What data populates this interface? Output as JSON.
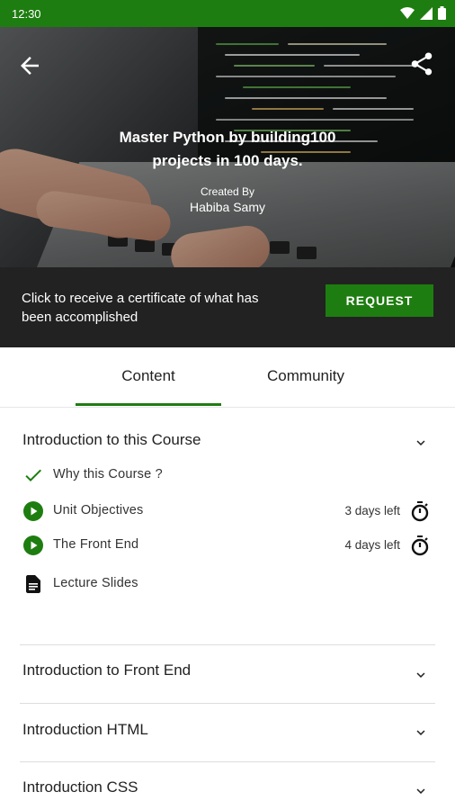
{
  "status_bar": {
    "time": "12:30"
  },
  "course": {
    "title": "Master Python by building100 projects in 100 days.",
    "created_by_label": "Created By",
    "author": "Habiba Samy"
  },
  "certificate": {
    "message": "Click to receive a certificate of what has been accomplished",
    "button_label": "REQUEST"
  },
  "tabs": [
    {
      "label": "Content",
      "active": true
    },
    {
      "label": "Community",
      "active": false
    }
  ],
  "sections": [
    {
      "title": "Introduction to this Course",
      "expanded": true,
      "lessons": [
        {
          "title": "Why this Course ?",
          "status": "completed",
          "icon": "check-icon"
        },
        {
          "title": "Unit Objectives",
          "status": "video",
          "icon": "play-circle-icon",
          "due": "3 days left"
        },
        {
          "title": "The Front End",
          "status": "video",
          "icon": "play-circle-icon",
          "due": "4 days left"
        },
        {
          "title": "Lecture Slides",
          "status": "document",
          "icon": "document-icon"
        }
      ]
    },
    {
      "title": "Introduction to Front End",
      "expanded": false
    },
    {
      "title": "Introduction HTML",
      "expanded": false
    },
    {
      "title": "Introduction CSS",
      "expanded": false
    }
  ],
  "colors": {
    "primary": "#1e7d10",
    "dark_bar": "#222222"
  }
}
